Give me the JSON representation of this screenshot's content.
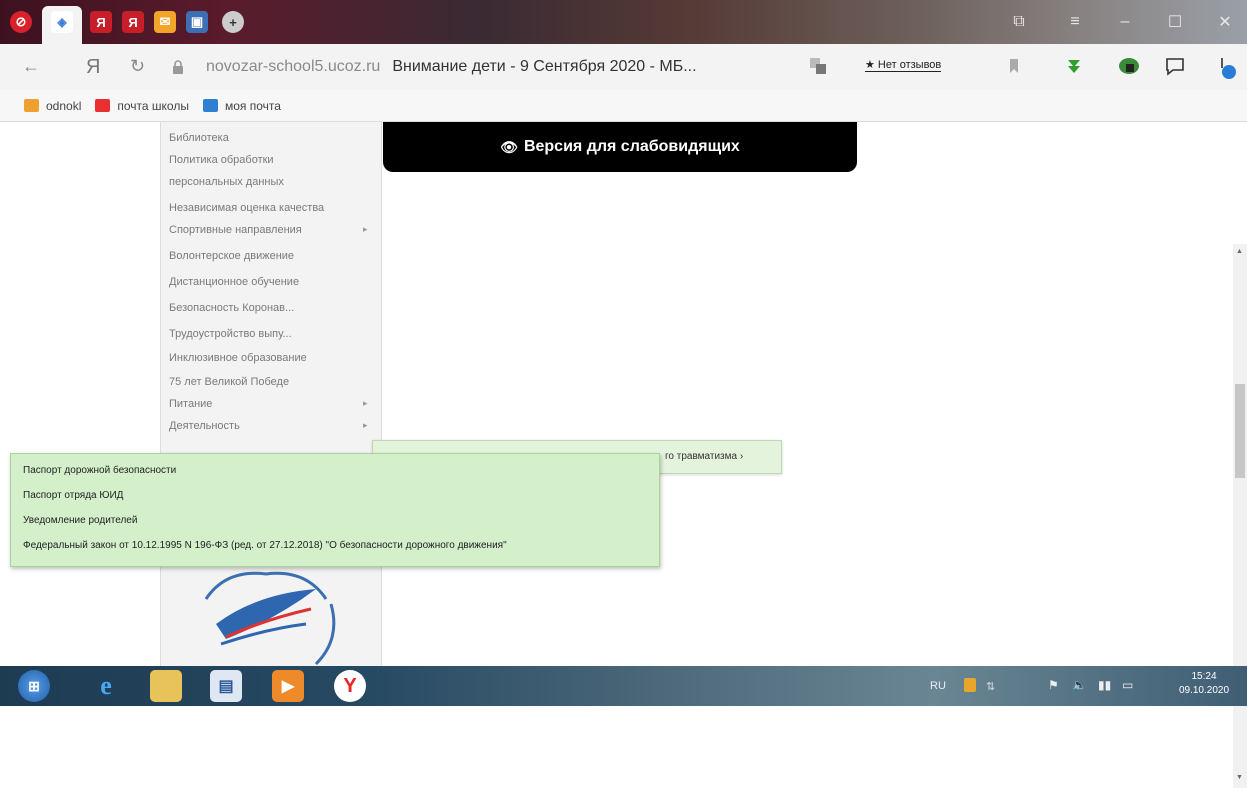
{
  "browser": {
    "address_logo": "Я",
    "url_domain": "novozar-school5.ucoz.ru",
    "page_title": "Внимание дети - 9 Сентября 2020 - МБ...",
    "reviews_label": "★ Нет отзывов"
  },
  "bookmarks": [
    {
      "label": "odnokl",
      "color": "#f0a030"
    },
    {
      "label": "почта школы",
      "color": "#e83030"
    },
    {
      "label": "моя почта",
      "color": "#2f80d0"
    }
  ],
  "page": {
    "version_button": "Версия для слабовидящих",
    "left_menu": [
      {
        "label": "Библиотека",
        "has_arrow": false
      },
      {
        "label": "Политика обработки",
        "has_arrow": false
      },
      {
        "label": "персональных данных",
        "has_arrow": false
      },
      {
        "label": "Независимая оценка качества",
        "has_arrow": false
      },
      {
        "label": "Спортивные направления",
        "has_arrow": true
      },
      {
        "label": "Волонтерское движение",
        "has_arrow": false
      },
      {
        "label": "Дистанционное обучение",
        "has_arrow": false
      },
      {
        "label": "Безопасность Коронав...",
        "has_arrow": false
      },
      {
        "label": "Трудоустройство выпу...",
        "has_arrow": false
      },
      {
        "label": "Инклюзивное образование",
        "has_arrow": false
      },
      {
        "label": "75 лет Великой Победе",
        "has_arrow": false
      },
      {
        "label": "Питание",
        "has_arrow": true
      },
      {
        "label": "Деятельность",
        "has_arrow": true
      }
    ],
    "submenu_right_label": "го травматизма ›",
    "submenu_items": [
      "Паспорт дорожной безопасности",
      "Паспорт отряда ЮИД",
      "Уведомление родителей",
      "Федеральный закон от 10.12.1995 N 196-ФЗ (ред. от 27.12.2018) \"О безопасности дорожного движения\""
    ]
  },
  "taskbar": {
    "lang": "RU",
    "time": "15:24",
    "date": "09.10.2020"
  },
  "colors": {
    "menu_green": "#d4f0cb",
    "version_bg": "#000000",
    "taskbar": "#274a63"
  }
}
